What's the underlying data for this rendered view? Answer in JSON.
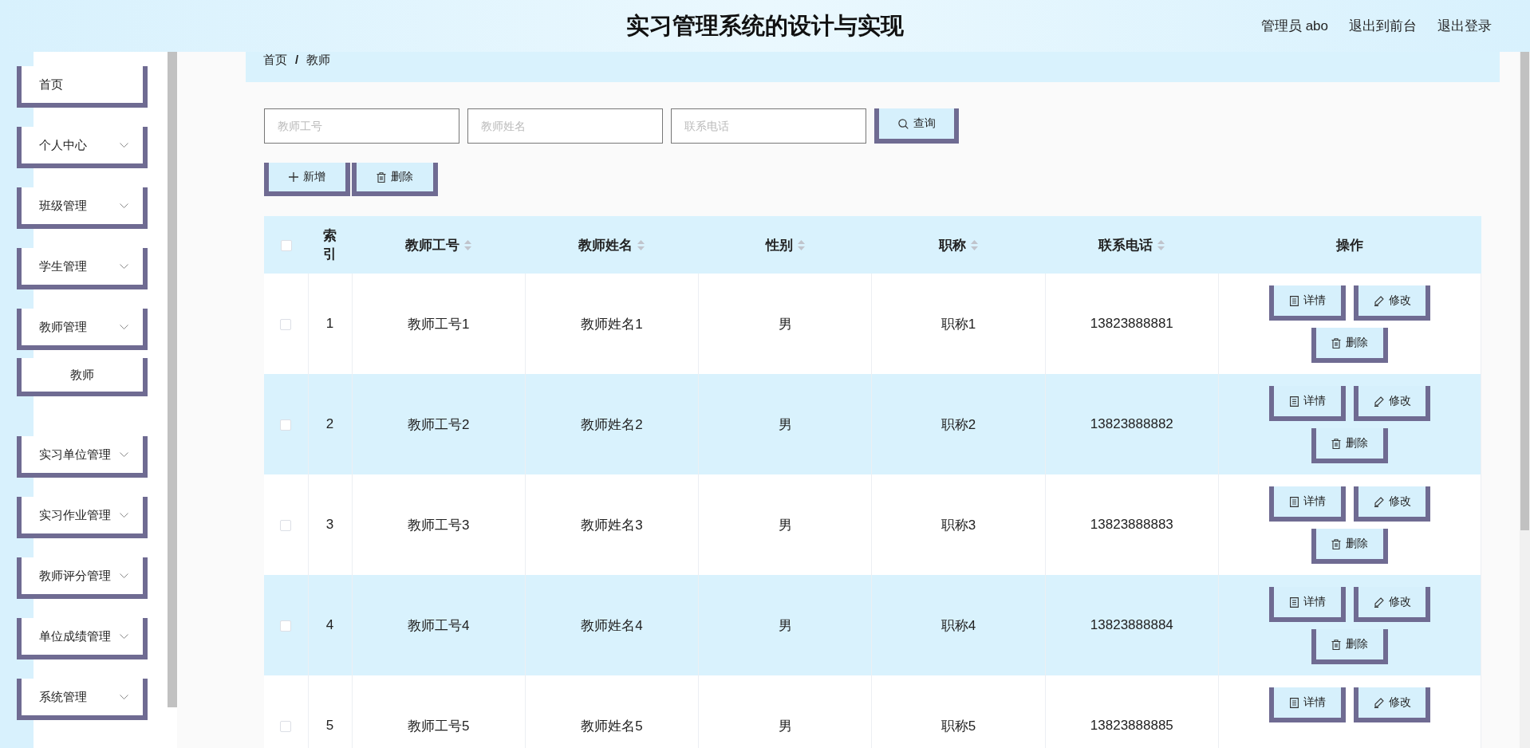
{
  "header": {
    "title": "实习管理系统的设计与实现",
    "links": [
      "管理员 abo",
      "退出到前台",
      "退出登录"
    ]
  },
  "sidebar": {
    "items": [
      {
        "label": "首页",
        "kind": "link"
      },
      {
        "label": "个人中心",
        "kind": "group"
      },
      {
        "label": "班级管理",
        "kind": "group"
      },
      {
        "label": "学生管理",
        "kind": "group"
      },
      {
        "label": "教师管理",
        "kind": "group",
        "children": [
          {
            "label": "教师"
          }
        ]
      },
      {
        "label": "实习单位管理",
        "kind": "group"
      },
      {
        "label": "实习作业管理",
        "kind": "group"
      },
      {
        "label": "教师评分管理",
        "kind": "group"
      },
      {
        "label": "单位成绩管理",
        "kind": "group"
      },
      {
        "label": "系统管理",
        "kind": "group"
      }
    ]
  },
  "breadcrumb": {
    "items": [
      "首页",
      "教师"
    ],
    "separator": "/"
  },
  "search": {
    "fields": [
      {
        "placeholder": "教师工号"
      },
      {
        "placeholder": "教师姓名"
      },
      {
        "placeholder": "联系电话"
      }
    ],
    "button": "查询"
  },
  "toolbar": [
    {
      "kind": "add",
      "label": "新增"
    },
    {
      "kind": "delete",
      "label": "删除"
    }
  ],
  "table": {
    "header_checked": false,
    "columns": [
      {
        "label": "索引",
        "sortable": false
      },
      {
        "label": "教师工号",
        "sortable": true
      },
      {
        "label": "教师姓名",
        "sortable": true
      },
      {
        "label": "性别",
        "sortable": true
      },
      {
        "label": "职称",
        "sortable": true
      },
      {
        "label": "联系电话",
        "sortable": true
      },
      {
        "label": "操作",
        "sortable": false
      }
    ],
    "rows": [
      {
        "checked": false,
        "cells": [
          "1",
          "教师工号1",
          "教师姓名1",
          "男",
          "职称1",
          "13823888881"
        ],
        "actions": [
          {
            "kind": "detail",
            "label": "详情"
          },
          {
            "kind": "edit",
            "label": "修改"
          },
          {
            "kind": "delete",
            "label": "删除"
          }
        ]
      },
      {
        "checked": false,
        "cells": [
          "2",
          "教师工号2",
          "教师姓名2",
          "男",
          "职称2",
          "13823888882"
        ],
        "actions": [
          {
            "kind": "detail",
            "label": "详情"
          },
          {
            "kind": "edit",
            "label": "修改"
          },
          {
            "kind": "delete",
            "label": "删除"
          }
        ]
      },
      {
        "checked": false,
        "cells": [
          "3",
          "教师工号3",
          "教师姓名3",
          "男",
          "职称3",
          "13823888883"
        ],
        "actions": [
          {
            "kind": "detail",
            "label": "详情"
          },
          {
            "kind": "edit",
            "label": "修改"
          },
          {
            "kind": "delete",
            "label": "删除"
          }
        ]
      },
      {
        "checked": false,
        "cells": [
          "4",
          "教师工号4",
          "教师姓名4",
          "男",
          "职称4",
          "13823888884"
        ],
        "actions": [
          {
            "kind": "detail",
            "label": "详情"
          },
          {
            "kind": "edit",
            "label": "修改"
          },
          {
            "kind": "delete",
            "label": "删除"
          }
        ]
      },
      {
        "checked": false,
        "cells": [
          "5",
          "教师工号5",
          "教师姓名5",
          "男",
          "职称5",
          "13823888885"
        ],
        "actions": [
          {
            "kind": "detail",
            "label": "详情"
          },
          {
            "kind": "edit",
            "label": "修改"
          }
        ]
      }
    ]
  }
}
